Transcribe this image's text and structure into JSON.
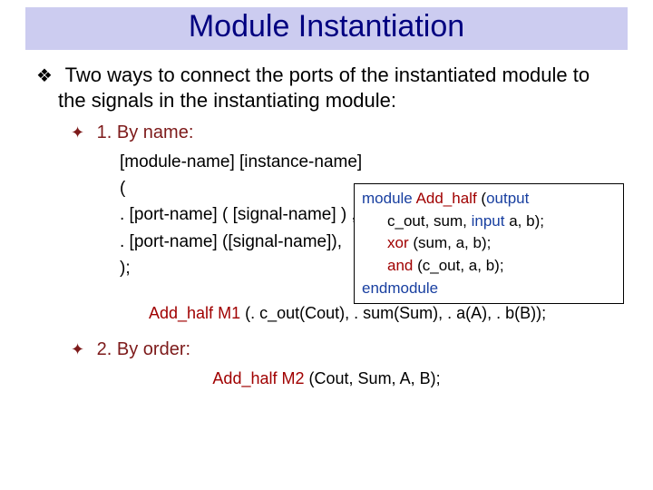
{
  "title": "Module Instantiation",
  "intro": "Two ways to connect the ports of the instantiated module to the signals in the instantiating module:",
  "sec1": {
    "heading": "1. By name:",
    "syntax": {
      "l1": "[module-name] [instance-name]",
      "l2": "(",
      "l3": ". [port-name] ( [signal-name] ) ,",
      "l4": ". [port-name] ([signal-name]),",
      "l5": ");"
    },
    "code": {
      "kw_module": "module",
      "modname": "Add_half",
      "paren_open": "(",
      "kw_output": "output",
      "outs": "c_out, sum,",
      "kw_input": "input",
      "ins": "a, b);",
      "xor_name": "xor",
      "xor_args": "(sum, a, b);",
      "and_name": "and",
      "and_args": "(c_out, a, b);",
      "kw_endmodule": "endmodule"
    },
    "example": {
      "mod": "Add_half",
      "inst": "M1",
      "rest": "(. c_out(Cout), . sum(Sum),  . a(A), . b(B));"
    }
  },
  "sec2": {
    "heading": "2. By order:",
    "example": {
      "mod": "Add_half",
      "inst": "M2",
      "rest": "(Cout, Sum,  A, B);"
    }
  }
}
